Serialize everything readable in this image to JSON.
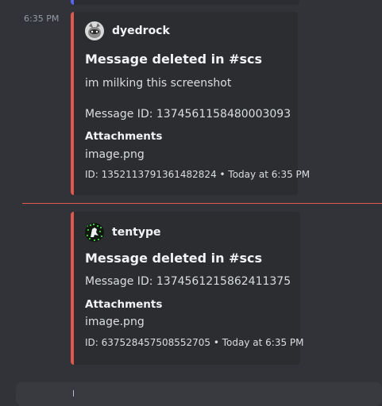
{
  "timestamp": "6:35 PM",
  "embeds": [
    {
      "author": "dyedrock",
      "avatar_icon": "raccoon-avatar-icon",
      "title": "Message deleted in #scs",
      "content": "im milking this screenshot",
      "message_id": "Message ID: 1374561158480003093",
      "attachments_label": "Attachments",
      "attachment": "image.png",
      "footer": "ID: 1352113791361482824 • Today at 6:35 PM"
    },
    {
      "author": "tentype",
      "avatar_icon": "green-pixel-avatar-icon",
      "title": "Message deleted in #scs",
      "message_id": "Message ID: 1374561215862411375",
      "attachments_label": "Attachments",
      "attachment": "image.png",
      "footer": "ID: 637528457508552705 • Today at 6:35 PM"
    }
  ],
  "colors": {
    "background": "#313338",
    "embed_background": "#2b2d31",
    "embed_accent": "#e0574e",
    "new_messages_divider": "#e0574e"
  }
}
